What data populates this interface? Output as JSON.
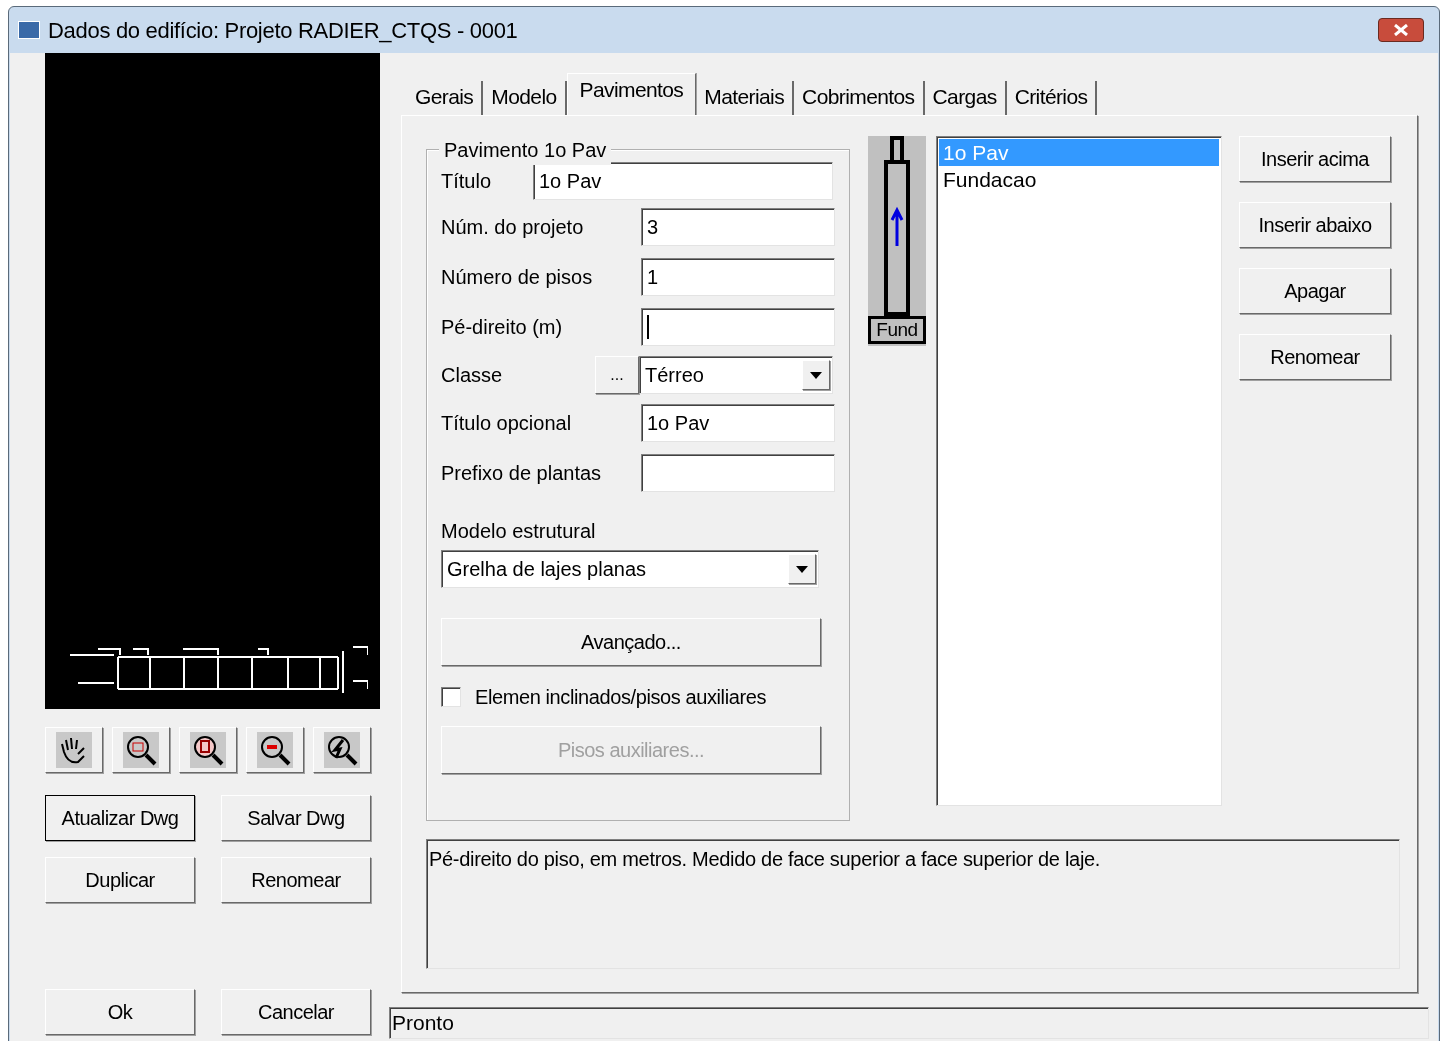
{
  "window": {
    "title": "Dados do edifício: Projeto RADIER_CTQS - 0001"
  },
  "left": {
    "tools": [
      {
        "kind": "hand"
      },
      {
        "kind": "zoom-window"
      },
      {
        "kind": "zoom-extents"
      },
      {
        "kind": "zoom-out"
      },
      {
        "kind": "zoom-previous"
      }
    ],
    "buttons": [
      {
        "label": "Atualizar Dwg",
        "focused": true
      },
      {
        "label": "Salvar Dwg",
        "focused": false
      },
      {
        "label": "Duplicar",
        "focused": false
      },
      {
        "label": "Renomear",
        "focused": false
      }
    ],
    "footer_buttons": [
      "Ok",
      "Cancelar"
    ]
  },
  "tabs": [
    {
      "label": "Gerais",
      "selected": false
    },
    {
      "label": "Modelo",
      "selected": false
    },
    {
      "label": "Pavimentos",
      "selected": true
    },
    {
      "label": "Materiais",
      "selected": false
    },
    {
      "label": "Cobrimentos",
      "selected": false
    },
    {
      "label": "Cargas",
      "selected": false
    },
    {
      "label": "Critérios",
      "selected": false
    }
  ],
  "group": {
    "title": "Pavimento 1o Pav",
    "fields": [
      {
        "kind": "wide_text",
        "label": "Título",
        "value": "1o Pav"
      },
      {
        "kind": "text",
        "label": "Núm. do projeto",
        "value": "3"
      },
      {
        "kind": "text",
        "label": "Número de pisos",
        "value": "1"
      },
      {
        "kind": "text",
        "label": "Pé-direito (m)",
        "focused": true
      },
      {
        "kind": "select",
        "label": "Classe",
        "button": "...",
        "value": "Térreo"
      },
      {
        "kind": "text",
        "label": "Título opcional",
        "value": "1o Pav"
      },
      {
        "kind": "text",
        "label": "Prefixo de plantas"
      }
    ],
    "model_label": "Modelo estrutural",
    "model_value": "Grelha de lajes planas",
    "advanced": {
      "label": "Avançado...",
      "disabled": false
    },
    "checkbox": {
      "label": "Elemen inclinados/pisos auxiliares",
      "checked": false
    },
    "aux": {
      "label": "Pisos auxiliares...",
      "disabled": true
    }
  },
  "tower": {
    "label": "Fund"
  },
  "floors": [
    {
      "label": "1o Pav",
      "selected": true
    },
    {
      "label": "Fundacao",
      "selected": false
    }
  ],
  "floor_buttons": [
    "Inserir acima",
    "Inserir abaixo",
    "Apagar",
    "Renomear"
  ],
  "help": "Pé-direito do piso, em metros. Medido de face superior a face superior de laje.",
  "status_bar": "Pronto"
}
